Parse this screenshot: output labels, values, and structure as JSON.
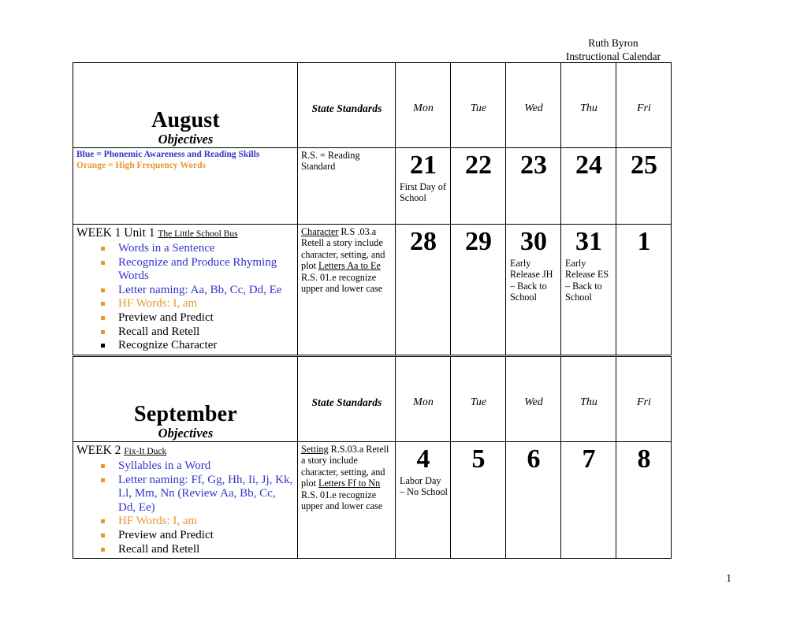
{
  "page": {
    "header_line1": "Ruth Byron",
    "header_line2": "Instructional Calendar",
    "page_number": "1"
  },
  "legend": {
    "blue": "Blue = Phonemic Awareness  and Reading Skills",
    "orange": "Orange = High Frequency Words"
  },
  "columns": {
    "standards_header": "State Standards",
    "days": [
      "Mon",
      "Tue",
      "Wed",
      "Thu",
      "Fri"
    ]
  },
  "august": {
    "month_name": "August",
    "month_sub": "Objectives",
    "standards_key": "R.S. = Reading Standard",
    "week_top": {
      "dates": [
        {
          "number": "21",
          "note": "First Day of School"
        },
        {
          "number": "22",
          "note": ""
        },
        {
          "number": "23",
          "note": ""
        },
        {
          "number": "24",
          "note": ""
        },
        {
          "number": "25",
          "note": ""
        }
      ]
    },
    "week1": {
      "title_week": "WEEK 1  Unit 1",
      "title_book": "The Little School Bus",
      "objectives": [
        {
          "text": "Words in a Sentence",
          "color": "blue",
          "bullet": "orange"
        },
        {
          "text": "Recognize and Produce Rhyming Words",
          "color": "blue",
          "bullet": "orange"
        },
        {
          "text": "Letter naming: Aa, Bb, Cc, Dd, Ee",
          "color": "blue",
          "bullet": "orange"
        },
        {
          "text": "HF Words: I, am",
          "color": "orange",
          "bullet": "orange"
        },
        {
          "text": "Preview and Predict",
          "color": "black",
          "bullet": "orange"
        },
        {
          "text": "Recall and Retell",
          "color": "black",
          "bullet": "orange"
        },
        {
          "text": "Recognize Character",
          "color": "black",
          "bullet": "black"
        }
      ],
      "standards": [
        {
          "underlined": "Character",
          "rest": " R.S .03.a Retell a story include character, setting, and plot"
        },
        {
          "underlined": "Letters Aa to Ee",
          "rest": "  R.S. 01.e recognize upper and lower case"
        }
      ],
      "dates": [
        {
          "number": "28",
          "note": ""
        },
        {
          "number": "29",
          "note": ""
        },
        {
          "number": "30",
          "note": "Early Release JH – Back to School"
        },
        {
          "number": "31",
          "note": "Early Release ES – Back to School"
        },
        {
          "number": "1",
          "note": ""
        }
      ]
    }
  },
  "september": {
    "month_name": "September",
    "month_sub": "Objectives",
    "week2": {
      "title_week": "WEEK 2",
      "title_book": "Fix-It Duck",
      "objectives": [
        {
          "text": "Syllables in a Word",
          "color": "blue",
          "bullet": "orange"
        },
        {
          "text": "Letter naming: Ff, Gg, Hh, Ii, Jj, Kk, Ll, Mm, Nn  (Review Aa, Bb, Cc, Dd, Ee)",
          "color": "blue",
          "bullet": "orange"
        },
        {
          "text": "HF Words: I, am",
          "color": "orange",
          "bullet": "orange"
        },
        {
          "text": "Preview and Predict",
          "color": "black",
          "bullet": "orange"
        },
        {
          "text": "Recall and Retell",
          "color": "black",
          "bullet": "orange"
        }
      ],
      "standards": [
        {
          "underlined": "Setting",
          "rest": " R.S.03.a Retell a story include character, setting, and plot"
        },
        {
          "underlined": "Letters Ff to Nn",
          "rest": "  R.S. 01.e recognize upper and lower case"
        }
      ],
      "dates": [
        {
          "number": "4",
          "note": "Labor Day – No School"
        },
        {
          "number": "5",
          "note": ""
        },
        {
          "number": "6",
          "note": ""
        },
        {
          "number": "7",
          "note": ""
        },
        {
          "number": "8",
          "note": ""
        }
      ]
    }
  },
  "colors": {
    "blue": "#3333cc",
    "orange": "#e8972a",
    "border": "#000000"
  }
}
